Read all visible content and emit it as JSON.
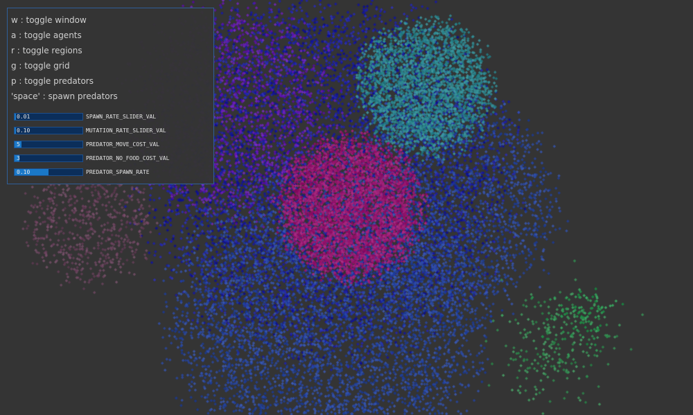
{
  "window": {
    "background_color": "#343434",
    "panel_border_color": "#2f5f9a",
    "slider_track_color": "#0b2e5a",
    "slider_fill_color": "#1a78c8"
  },
  "help_panel": {
    "key_bindings": [
      {
        "text": "w : toggle window"
      },
      {
        "text": "a : toggle agents"
      },
      {
        "text": "r : toggle regions"
      },
      {
        "text": "g : toggle grid"
      },
      {
        "text": "p : toggle predators"
      },
      {
        "text": "'space' : spawn predators"
      }
    ],
    "sliders": [
      {
        "name": "SPAWN_RATE_SLIDER_VAL",
        "value": "0.01",
        "level": 0.02
      },
      {
        "name": "MUTATION_RATE_SLIDER_VAL",
        "value": "0.10",
        "level": 0.02
      },
      {
        "name": "PREDATOR_MOVE_COST_VAL",
        "value": "5",
        "level": 0.1
      },
      {
        "name": "PREDATOR_NO_FOOD_COST_VAL",
        "value": "3",
        "level": 0.07
      },
      {
        "name": "PREDATOR_SPAWN_RATE",
        "value": "0.10",
        "level": 0.5
      }
    ]
  },
  "simulation": {
    "agent_clusters": [
      {
        "color": "#6a1ab8"
      },
      {
        "color": "#2f8a92"
      },
      {
        "color": "#9a1a72"
      },
      {
        "color": "#2a4aa8"
      },
      {
        "color": "#1c1fa8"
      },
      {
        "color": "#7a4a6a"
      },
      {
        "color": "#2a9a52"
      },
      {
        "color": "#3a9a5a"
      }
    ]
  }
}
